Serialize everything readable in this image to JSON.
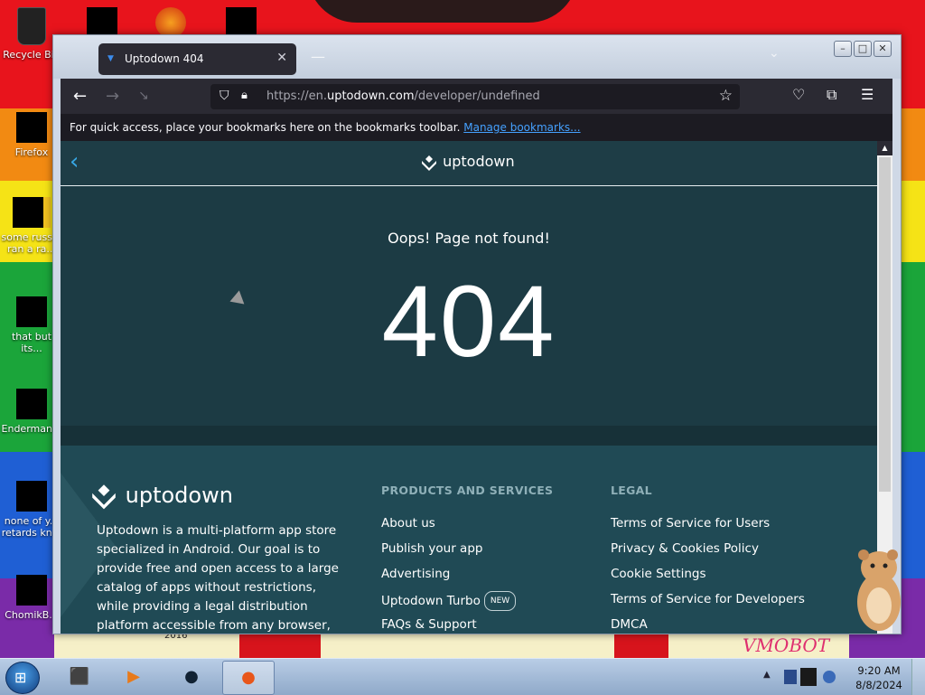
{
  "desktop": {
    "icons": [
      {
        "label": "Recycle Bin"
      },
      {
        "label": "Firefox"
      },
      {
        "label": "some russ... ran a ra..."
      },
      {
        "label": "that but its..."
      },
      {
        "label": "Enderman..."
      },
      {
        "label": "none of y... retards kn..."
      },
      {
        "label": "ChomikB..."
      }
    ],
    "wallpaper_text": "2016",
    "watermark": "VMOBOT"
  },
  "browser": {
    "tab_title": "Uptodown 404",
    "url_prefix": "https://en.",
    "url_domain": "uptodown.com",
    "url_path": "/developer/undefined",
    "bookmarks_bar_text": "For quick access, place your bookmarks here on the bookmarks toolbar.",
    "manage_bookmarks": "Manage bookmarks..."
  },
  "page": {
    "brand": "uptodown",
    "oops": "Oops! Page not found!",
    "code": "404",
    "footer": {
      "brand": "uptodown",
      "about": "Uptodown is a multi-platform app store specialized in Android. Our goal is to provide free and open access to a large catalog of apps without restrictions, while providing a legal distribution platform accessible from any browser, and also",
      "products_heading": "PRODUCTS AND SERVICES",
      "products": [
        {
          "label": "About us"
        },
        {
          "label": "Publish your app"
        },
        {
          "label": "Advertising"
        },
        {
          "label": "Uptodown Turbo",
          "badge": "NEW"
        },
        {
          "label": "FAQs & Support"
        }
      ],
      "legal_heading": "LEGAL",
      "legal": [
        {
          "label": "Terms of Service for Users"
        },
        {
          "label": "Privacy & Cookies Policy"
        },
        {
          "label": "Cookie Settings"
        },
        {
          "label": "Terms of Service for Developers"
        },
        {
          "label": "DMCA"
        }
      ]
    }
  },
  "taskbar": {
    "time": "9:20 AM",
    "date": "8/8/2024"
  }
}
